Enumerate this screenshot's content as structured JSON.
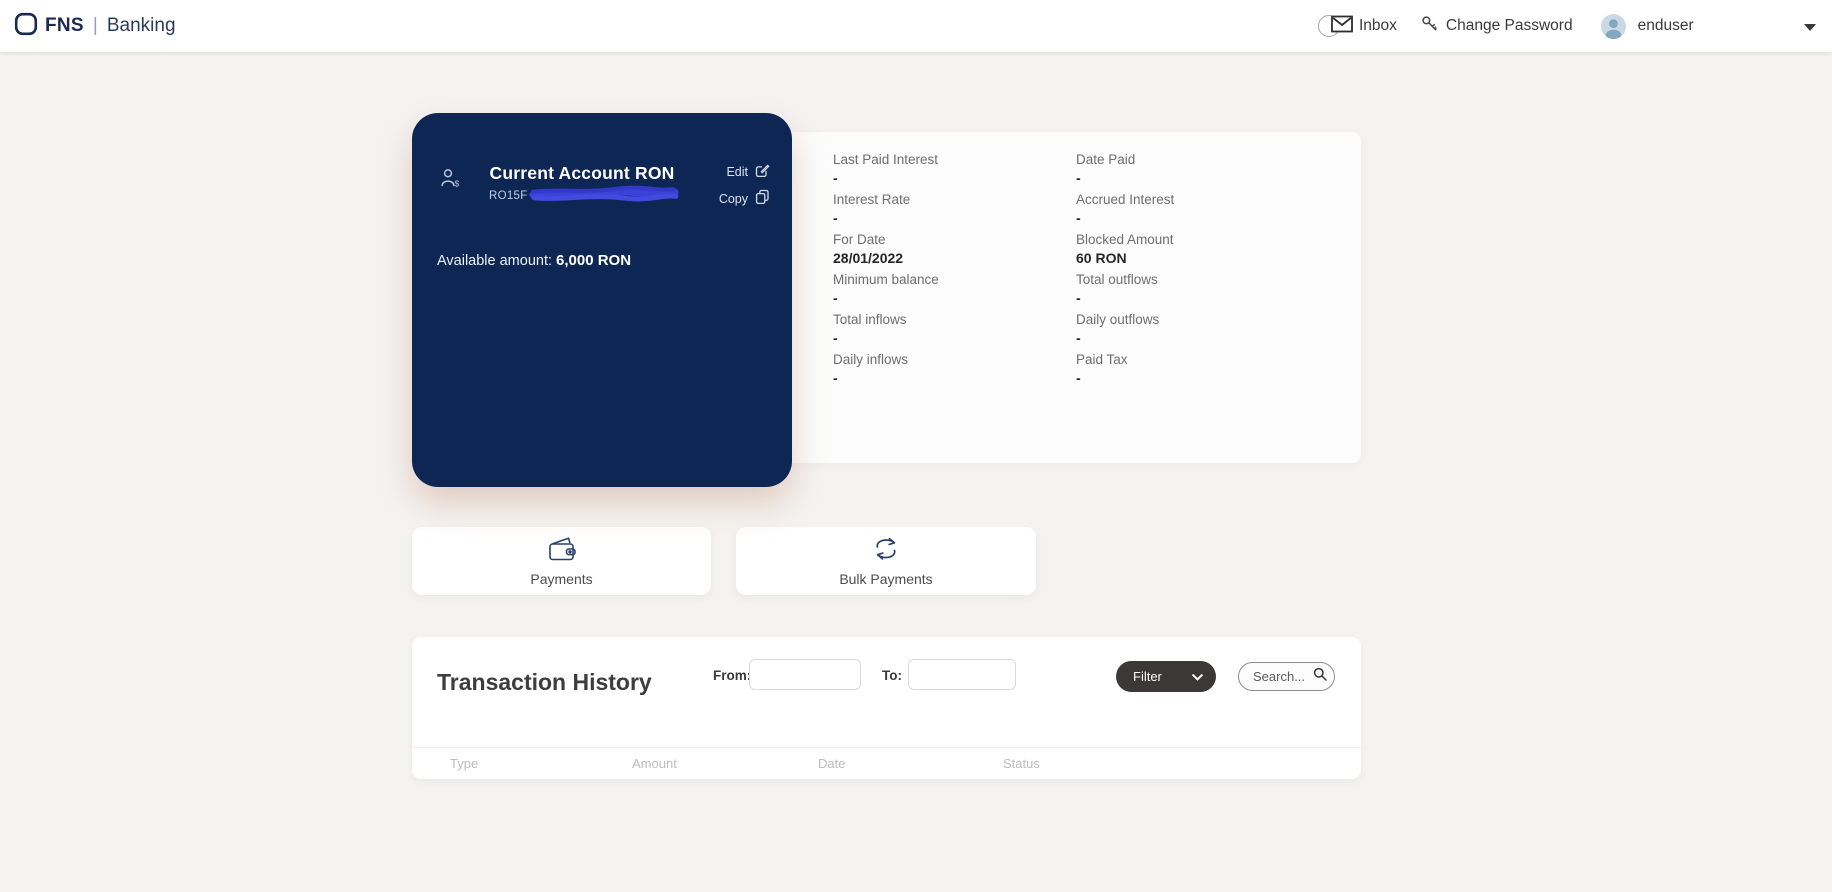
{
  "header": {
    "brand": {
      "name": "FNS",
      "separator": "|",
      "product": "Banking"
    },
    "inbox_label": "Inbox",
    "change_password_label": "Change Password",
    "username": "enduser"
  },
  "account_card": {
    "title": "Current Account RON",
    "iban_visible_prefix": "RO15F",
    "edit_label": "Edit",
    "copy_label": "Copy",
    "available_label": "Available amount:",
    "available_value": "6,000 RON"
  },
  "account_details": {
    "col1": [
      {
        "label": "Last Paid Interest",
        "value": "-"
      },
      {
        "label": "Interest Rate",
        "value": "-"
      },
      {
        "label": "For Date",
        "value": "28/01/2022"
      },
      {
        "label": "Minimum balance",
        "value": "-"
      },
      {
        "label": "Total inflows",
        "value": "-"
      },
      {
        "label": "Daily inflows",
        "value": "-"
      }
    ],
    "col2": [
      {
        "label": "Date Paid",
        "value": "-"
      },
      {
        "label": "Accrued Interest",
        "value": "-"
      },
      {
        "label": "Blocked Amount",
        "value": "60 RON"
      },
      {
        "label": "Total outflows",
        "value": "-"
      },
      {
        "label": "Daily outflows",
        "value": "-"
      },
      {
        "label": "Paid Tax",
        "value": "-"
      }
    ]
  },
  "actions": {
    "payments_label": "Payments",
    "bulk_payments_label": "Bulk Payments"
  },
  "transactions": {
    "title": "Transaction History",
    "from_label": "From:",
    "from_value": "",
    "to_label": "To:",
    "to_value": "",
    "filter_label": "Filter",
    "search_placeholder": "Search...",
    "table_headers": {
      "type": "Type",
      "amount": "Amount",
      "date": "Date",
      "status": "Status"
    },
    "rows": []
  },
  "colors": {
    "navy_card": "#0d2654",
    "brand_navy": "#1b2a4e",
    "filter_button": "#3a3938",
    "redaction_scribble": "#3c42d8",
    "avatar_bg": "#c9d9e4",
    "avatar_person": "#84a7c0",
    "page_background": "#f5f3f2"
  }
}
